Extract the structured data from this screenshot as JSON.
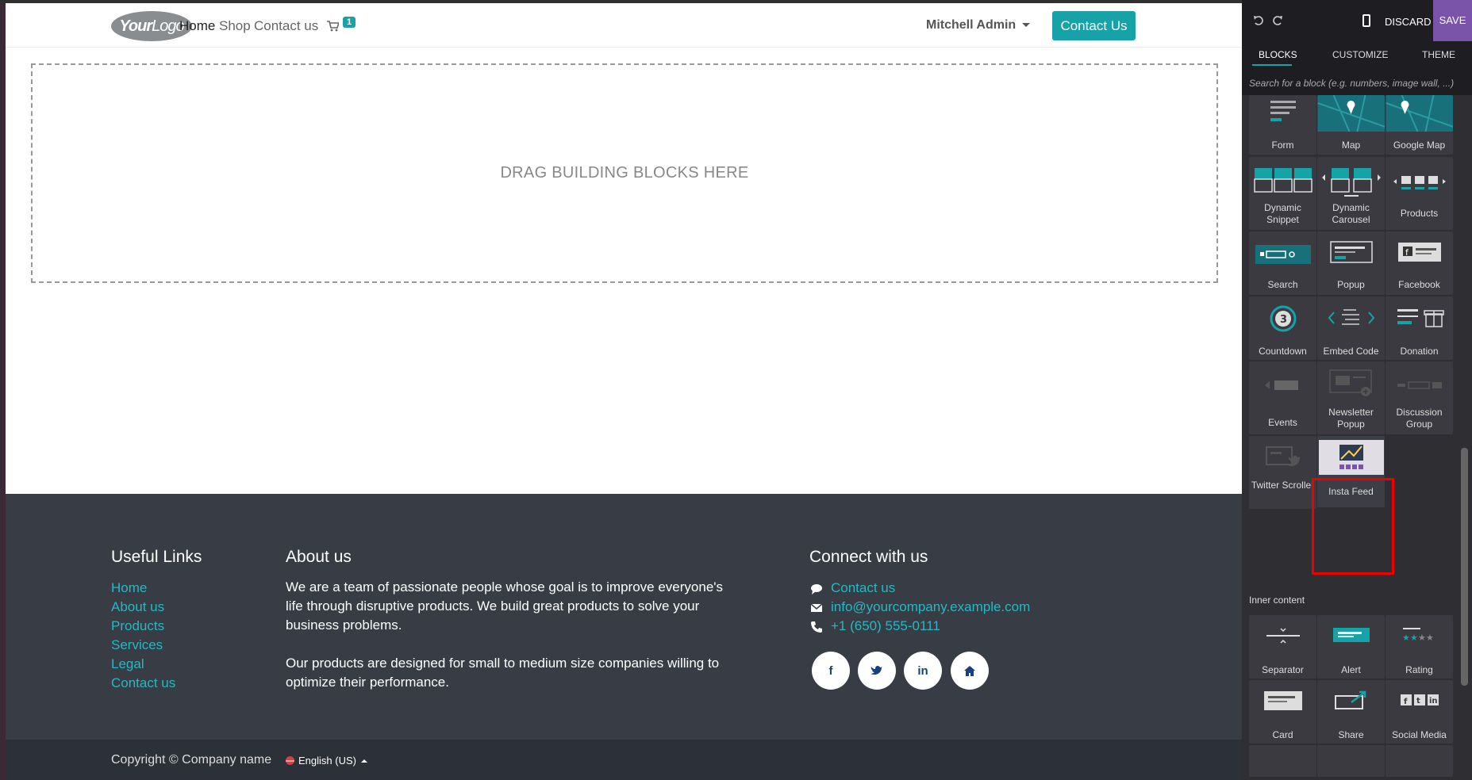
{
  "site": {
    "logo": {
      "bold": "Your",
      "light": "Logo"
    },
    "nav": [
      {
        "label": "Home",
        "active": true
      },
      {
        "label": "Shop"
      },
      {
        "label": "Contact us"
      }
    ],
    "cart_count": "1",
    "user": "Mitchell Admin",
    "cta": "Contact Us",
    "dropzone": "DRAG BUILDING BLOCKS HERE"
  },
  "footer": {
    "useful_links": {
      "title": "Useful Links",
      "links": [
        "Home",
        "About us",
        "Products",
        "Services",
        "Legal",
        "Contact us"
      ]
    },
    "about": {
      "title": "About us",
      "p1": [
        "We are a team of passionate people whose goal is to improve everyone's",
        "life through disruptive products. We build great products to solve your",
        "business problems."
      ],
      "p2": [
        "Our products are designed for small to medium size companies willing to",
        "optimize their performance."
      ]
    },
    "connect": {
      "title": "Connect with us",
      "contact": "Contact us",
      "email": "info@yourcompany.example.com",
      "phone": "+1 (650) 555-0111"
    },
    "copyright": "Copyright © Company name",
    "language": "English (US)"
  },
  "editor": {
    "discard": "DISCARD",
    "save": "SAVE",
    "tabs": [
      "BLOCKS",
      "CUSTOMIZE",
      "THEME"
    ],
    "active_tab": "BLOCKS",
    "search_placeholder": "Search for a block (e.g. numbers, image wall, ...)",
    "blocks": [
      "Form",
      "Map",
      "Google Map",
      "Dynamic Snippet",
      "Dynamic Carousel",
      "Products",
      "Search",
      "Popup",
      "Facebook",
      "Countdown",
      "Embed Code",
      "Donation",
      "Events",
      "Newsletter Popup",
      "Discussion Group",
      "Twitter Scroller",
      "Insta Feed"
    ],
    "highlighted_block": "Insta Feed",
    "inner_content_heading": "Inner content",
    "inner_blocks": [
      "Separator",
      "Alert",
      "Rating",
      "Card",
      "Share",
      "Social Media"
    ]
  },
  "colors": {
    "accent": "#17a2a8",
    "save": "#7a54a8",
    "footer": "#373c45",
    "panel": "#2f2f33",
    "highlight": "#ee0000"
  }
}
